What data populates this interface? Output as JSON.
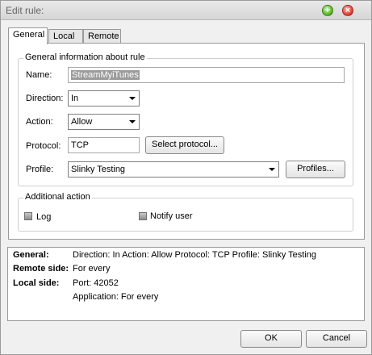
{
  "window": {
    "title": "Edit rule:"
  },
  "titlebar_buttons": {
    "maximize_glyph": "+",
    "close_glyph": "×"
  },
  "tabs": [
    {
      "label": "General",
      "active": true
    },
    {
      "label": "Local",
      "active": false
    },
    {
      "label": "Remote",
      "active": false
    }
  ],
  "general_group": {
    "title": "General information about rule",
    "name_label": "Name:",
    "name_value": "StreamMyiTunes",
    "direction_label": "Direction:",
    "direction_value": "In",
    "action_label": "Action:",
    "action_value": "Allow",
    "protocol_label": "Protocol:",
    "protocol_value": "TCP",
    "select_protocol_label": "Select protocol...",
    "profile_label": "Profile:",
    "profile_value": "Slinky Testing",
    "profiles_button_label": "Profiles..."
  },
  "additional_group": {
    "title": "Additional action",
    "log_label": "Log",
    "log_checked": false,
    "notify_label": "Notify user",
    "notify_checked": false
  },
  "summary": {
    "general_key": "General:",
    "general_value": "Direction: In   Action: Allow   Protocol: TCP   Profile: Slinky Testing",
    "remote_key": "Remote side:",
    "remote_value": "For every",
    "local_key": "Local side:",
    "local_port": "Port: 42052",
    "local_app": "Application: For every"
  },
  "footer": {
    "ok_label": "OK",
    "cancel_label": "Cancel"
  }
}
